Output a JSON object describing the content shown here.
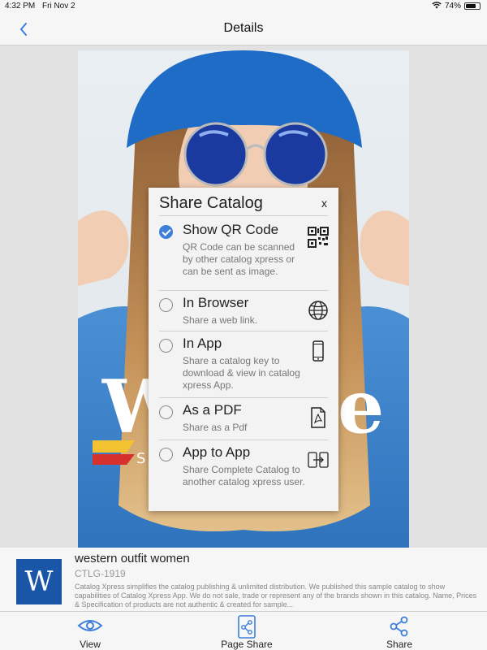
{
  "status_bar": {
    "time": "4:32 PM",
    "date": "Fri Nov 2",
    "battery": "74%",
    "battery_level": 0.74
  },
  "nav": {
    "title": "Details"
  },
  "modal": {
    "title": "Share Catalog",
    "close": "x",
    "options": [
      {
        "title": "Show QR Code",
        "desc": "QR Code can be scanned by other catalog xpress or can be sent as image.",
        "checked": true,
        "icon": "qr-code-icon"
      },
      {
        "title": "In Browser",
        "desc": "Share a web link.",
        "checked": false,
        "icon": "globe-icon"
      },
      {
        "title": "In App",
        "desc": "Share a catalog key to download & view in catalog xpress App.",
        "checked": false,
        "icon": "phone-icon"
      },
      {
        "title": "As a PDF",
        "desc": "Share as a Pdf",
        "checked": false,
        "icon": "pdf-icon"
      },
      {
        "title": "App to App",
        "desc": "Share Complete Catalog to another catalog xpress user.",
        "checked": false,
        "icon": "app-transfer-icon"
      }
    ]
  },
  "catalog": {
    "thumb_letter": "W",
    "name": "western outfit women",
    "code": "CTLG-1919",
    "description": "Catalog Xpress simplifies the catalog publishing & unlimited distribution. We published this sample catalog to show capabilities of Catalog Xpress App. We do not sale, trade or represent any of the brands shown in this catalog. Name, Prices & Specification of products are not authentic & created for sample...",
    "cover_text_left": "W",
    "cover_text_right": "e",
    "cover_sub": "S"
  },
  "tabs": [
    {
      "label": "View",
      "icon": "eye-icon"
    },
    {
      "label": "Page Share",
      "icon": "page-share-icon"
    },
    {
      "label": "Share",
      "icon": "share-icon"
    }
  ],
  "colors": {
    "accent": "#3d7fd9",
    "thumb": "#1a56a8"
  }
}
